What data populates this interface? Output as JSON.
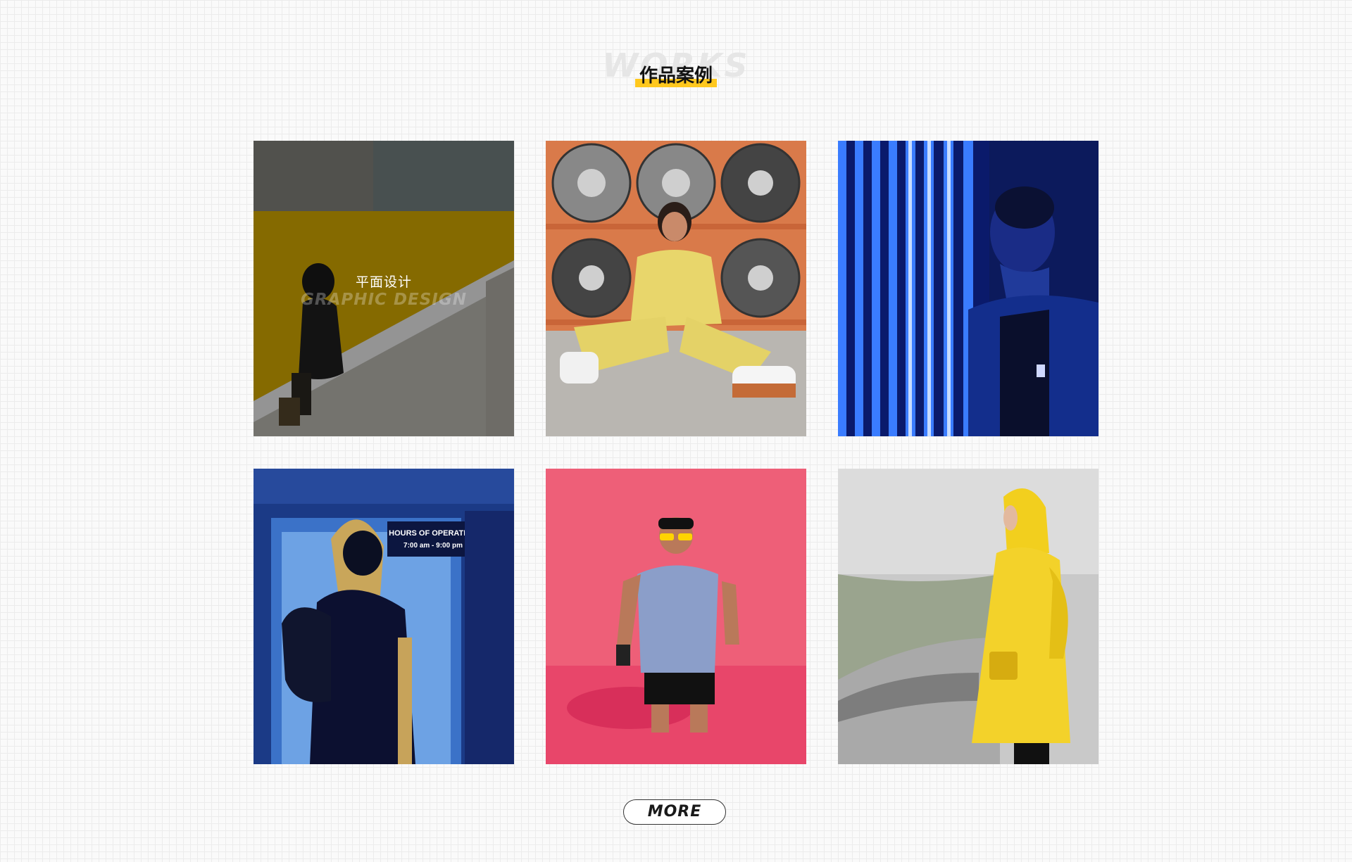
{
  "header": {
    "background_word": "WORKS",
    "title": "作品案例",
    "accent_color": "#ffc81e"
  },
  "works": {
    "items": [
      {
        "category_cn": "平面设计",
        "category_en": "GRAPHIC DESIGN",
        "hovered": true,
        "scene": "man-on-yellow-staircase"
      },
      {
        "scene": "woman-in-yellow-jumpsuit-with-wheels"
      },
      {
        "scene": "man-in-blue-light-stripes"
      },
      {
        "scene": "hooded-man-at-elevator",
        "sign_line_1": "HOURS OF OPERATION",
        "sign_line_2": "7:00 am - 9:00 pm"
      },
      {
        "scene": "man-in-pink-water-with-sunglasses"
      },
      {
        "scene": "person-in-yellow-raincoat-in-fog"
      }
    ]
  },
  "more_button": {
    "label": "MORE"
  }
}
